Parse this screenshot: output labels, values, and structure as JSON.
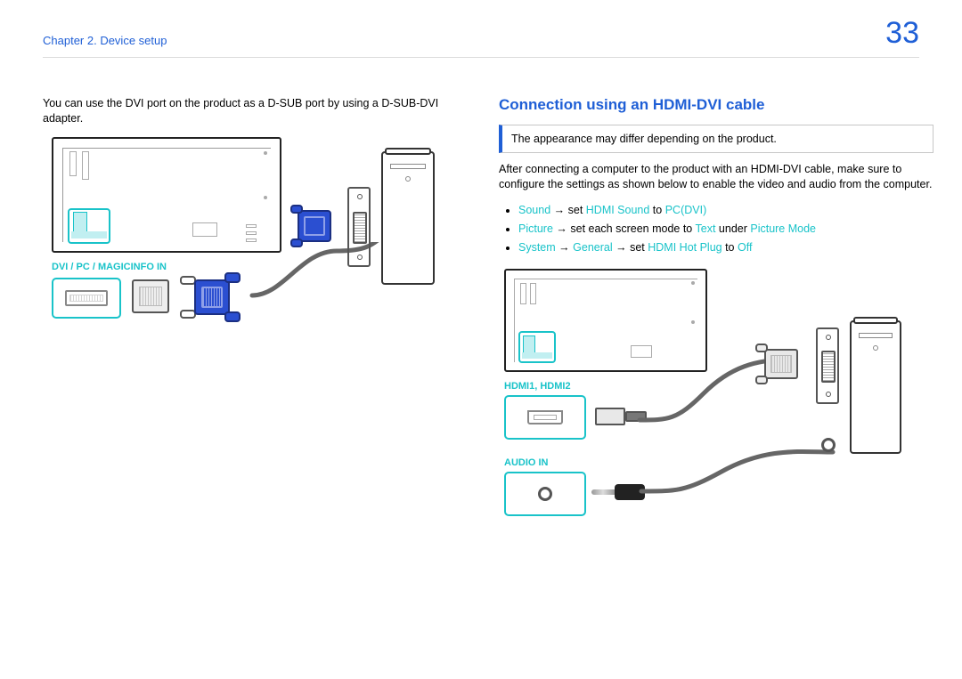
{
  "header": {
    "chapter": "Chapter 2. Device setup",
    "page_number": "33"
  },
  "left": {
    "para": "You can use the DVI port on the product as a D-SUB port by using a D-SUB-DVI adapter.",
    "port_label": "DVI / PC / MAGICINFO IN"
  },
  "right": {
    "heading": "Connection using an HDMI-DVI cable",
    "note": "The appearance may differ depending on the product.",
    "para": "After connecting a computer to the product with an HDMI-DVI cable, make sure to configure the settings as shown below to enable the video and audio from the computer.",
    "bullets": {
      "sound": {
        "a": "Sound",
        "arrow": "→",
        "mid": " set ",
        "b": "HDMI Sound",
        "to": " to ",
        "c": "PC(DVI)"
      },
      "picture": {
        "a": "Picture",
        "arrow": "→",
        "mid": " set each screen mode to ",
        "b": "Text",
        "under": " under ",
        "c": "Picture Mode"
      },
      "system": {
        "a": "System",
        "arrow1": "→",
        "b": "General",
        "arrow2": "→",
        "mid": " set ",
        "c": "HDMI Hot Plug",
        "to": " to ",
        "d": "Off"
      }
    },
    "hdmi_label": "HDMI1, HDMI2",
    "audio_label": "AUDIO IN"
  }
}
